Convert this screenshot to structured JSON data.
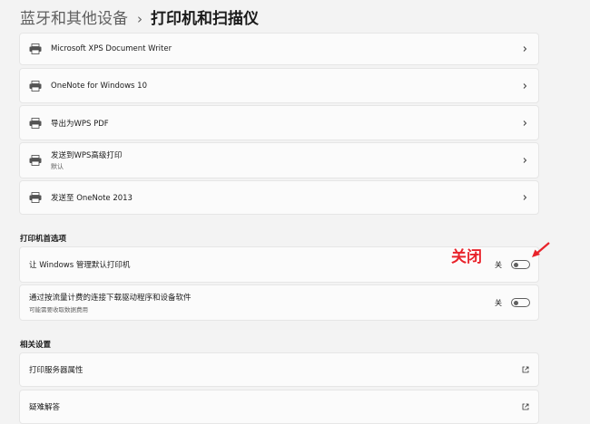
{
  "breadcrumb": {
    "parent": "蓝牙和其他设备",
    "separator": "›",
    "current": "打印机和扫描仪"
  },
  "devices": [
    {
      "name": "Microsoft XPS Document Writer",
      "icon": "printer-icon"
    },
    {
      "name": "OneNote for Windows 10",
      "icon": "printer-icon"
    },
    {
      "name": "导出为WPS PDF",
      "icon": "printer-icon"
    },
    {
      "name": "发送到WPS高级打印",
      "sub": "默认",
      "icon": "printer-icon"
    },
    {
      "name": "发送至 OneNote 2013",
      "icon": "printer-icon"
    }
  ],
  "printer_prefs": {
    "title": "打印机首选项",
    "options": [
      {
        "label": "让 Windows 管理默认打印机",
        "state": "关",
        "on": false
      },
      {
        "label": "通过按流量计费的连接下载驱动程序和设备软件",
        "sub": "可能需要收取数据费用",
        "state": "关",
        "on": false
      }
    ]
  },
  "related": {
    "title": "相关设置",
    "items": [
      {
        "label": "打印服务器属性",
        "icon": "external-link-icon"
      },
      {
        "label": "疑难解答",
        "icon": "external-link-icon"
      }
    ]
  },
  "annotation": {
    "text": "关闭",
    "color": "#e8232b"
  }
}
